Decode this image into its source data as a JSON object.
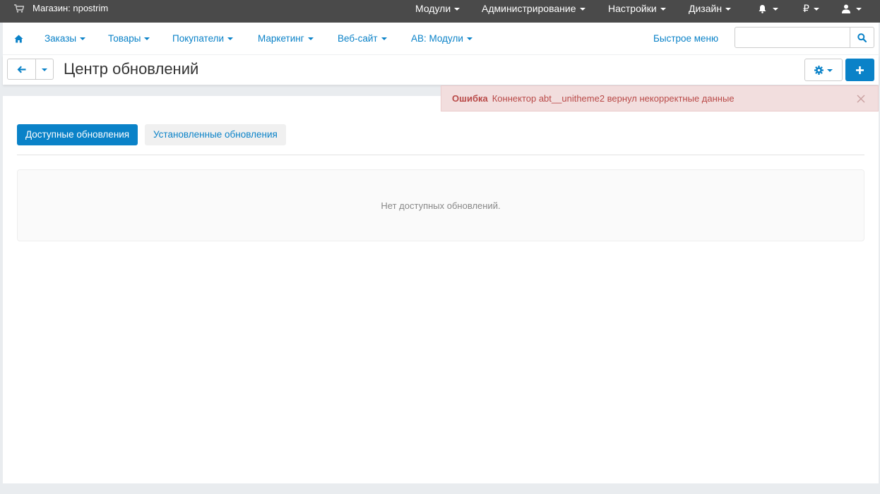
{
  "topbar": {
    "store_label": "Магазин: npostrim",
    "menus": [
      "Модули",
      "Администрирование",
      "Настройки",
      "Дизайн"
    ],
    "currency": "₽"
  },
  "nav": {
    "items": [
      "Заказы",
      "Товары",
      "Покупатели",
      "Маркетинг",
      "Веб-сайт",
      "AB: Модули"
    ],
    "quick_menu": "Быстрое меню",
    "search_value": "",
    "search_placeholder": ""
  },
  "page": {
    "title": "Центр обновлений"
  },
  "alert": {
    "label": "Ошибка",
    "message": "Коннектор abt__unitheme2 вернул некорректные данные"
  },
  "tabs": [
    "Доступные обновления",
    "Установленные обновления"
  ],
  "empty_message": "Нет доступных обновлений.",
  "colors": {
    "accent": "#0a82c8",
    "topbar": "#4a4a4a",
    "alert_bg": "#f2dede",
    "alert_text": "#b94a48"
  }
}
